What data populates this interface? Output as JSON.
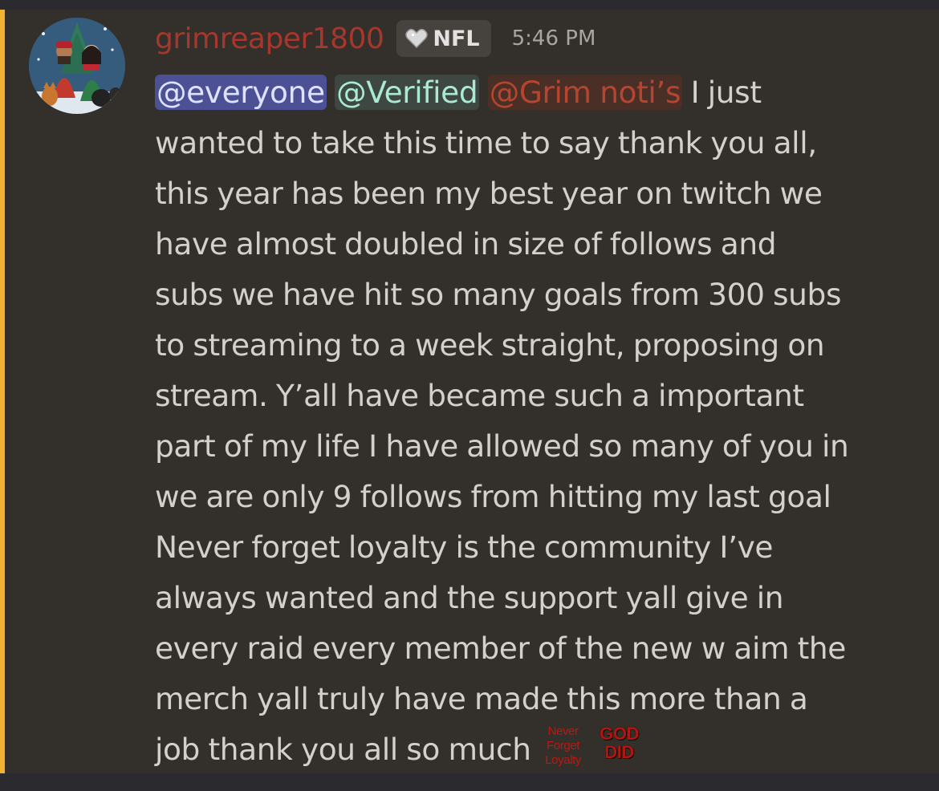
{
  "message": {
    "author": {
      "username": "grimreaper1800",
      "server_tag": {
        "icon": "heart-badge-icon",
        "label": "NFL"
      },
      "avatar": "avatar-icon"
    },
    "timestamp": "5:46 PM",
    "mentions": [
      "@everyone",
      "@Verified",
      "@Grim noti’s"
    ],
    "lines": [
      " I just",
      "wanted to take this time to say thank you all,",
      "this year has been my best year on twitch we",
      "have almost doubled in size of follows and",
      "subs we have hit so many goals from 300 subs",
      "to streaming to a week straight, proposing on",
      "stream. Y’all have became such a important",
      "part of my life I have allowed so many of you in",
      "we are only 9 follows from hitting my last goal",
      "Never forget loyalty is the community I’ve",
      "always wanted and the support yall give in",
      "every raid every member of the new w aim the",
      "merch yall truly have made this more than a",
      "job thank you all so much"
    ],
    "emojis": [
      {
        "name": "never-forget-loyalty-emoji",
        "lines": [
          "Never",
          "Forget",
          "Loyalty"
        ]
      },
      {
        "name": "god-did-emoji",
        "lines": [
          "GOD",
          "DID"
        ]
      }
    ]
  },
  "colors": {
    "background": "#2a2a2f",
    "message_highlight": "#332f2b",
    "mention_bar": "#f0b232",
    "username": "#a6372c",
    "everyone_mention_bg": "#4c5196",
    "verified_mention_bg": "#3e4741",
    "grim_mention_bg": "#4a2f27"
  }
}
